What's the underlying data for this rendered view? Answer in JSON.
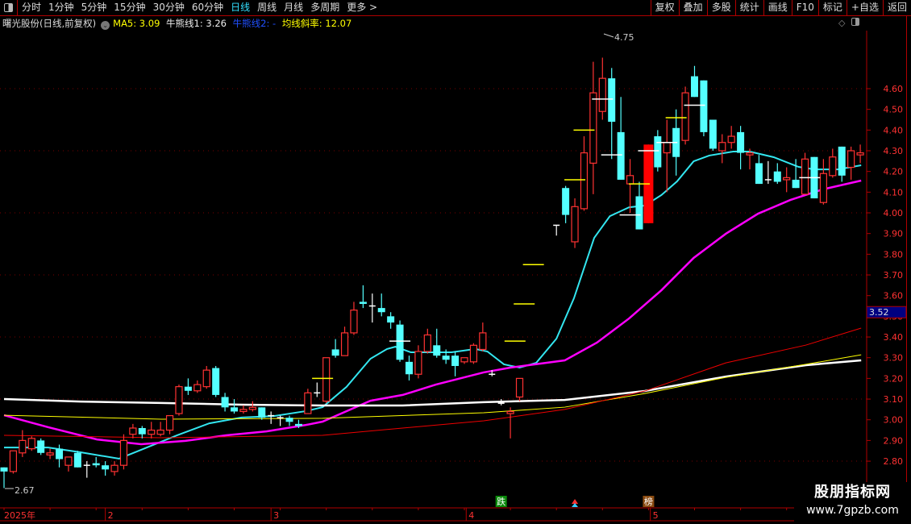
{
  "toolbar": {
    "periods": [
      "分时",
      "1分钟",
      "5分钟",
      "15分钟",
      "30分钟",
      "60分钟",
      "日线",
      "周线",
      "月线",
      "多周期",
      "更多 >"
    ],
    "active_period": "日线",
    "tools": [
      "复权",
      "叠加",
      "多股",
      "统计",
      "画线",
      "F10",
      "标记",
      "+自选",
      "返回"
    ]
  },
  "info": {
    "title": "曙光股份(日线,前复权)",
    "ma5": "MA5: 3.09",
    "bull_bear1": "牛熊线1: 3.26",
    "bull_bear2": "牛熊线2: -",
    "slope": "均线斜率: 12.07"
  },
  "colors": {
    "up": "#ff3232",
    "down": "#54ffff",
    "doji": "#ffffff",
    "axis": "#b00000",
    "axis_text": "#ff3232",
    "ma_cyan": "#33e6f0",
    "ma_magenta": "#ff00ff",
    "ma_white": "#ffffff",
    "ma_yellow": "#ffff00",
    "ma_red": "#ee0000"
  },
  "price_axis": {
    "labels": [
      "4.60",
      "4.50",
      "4.40",
      "4.30",
      "4.20",
      "4.10",
      "4.00",
      "3.90",
      "3.80",
      "3.70",
      "3.60",
      "3.50",
      "3.40",
      "3.30",
      "3.20",
      "3.10",
      "3.00",
      "2.90",
      "2.80"
    ],
    "current_price": "3.52"
  },
  "annotations": {
    "high": "4.75",
    "low": "2.67"
  },
  "date_axis": [
    {
      "label": "2025年",
      "i": 0
    },
    {
      "label": "2",
      "i": 11
    },
    {
      "label": "3",
      "i": 29
    },
    {
      "label": "4",
      "i": 50.2
    },
    {
      "label": "5",
      "i": 70.2
    }
  ],
  "signals": [
    {
      "label": "跌",
      "i": 54,
      "color": "#0a8a0a"
    },
    {
      "label": "榜",
      "i": 70,
      "color": "#8a4a10"
    }
  ],
  "watermark": {
    "line1": "股朋指标网",
    "line2": "www.7gpzb.com"
  },
  "chart_data": {
    "type": "candlestick",
    "ylim": [
      2.62,
      4.85
    ],
    "candles": [
      [
        2.77,
        2.77,
        2.67,
        2.75
      ],
      [
        2.75,
        2.85,
        2.74,
        2.85
      ],
      [
        2.84,
        2.95,
        2.82,
        2.9
      ],
      [
        2.86,
        2.92,
        2.85,
        2.91
      ],
      [
        2.9,
        2.91,
        2.83,
        2.84
      ],
      [
        2.83,
        2.86,
        2.81,
        2.84
      ],
      [
        2.86,
        2.88,
        2.77,
        2.81
      ],
      [
        2.78,
        2.82,
        2.75,
        2.82
      ],
      [
        2.84,
        2.85,
        2.77,
        2.77
      ],
      [
        2.78,
        2.8,
        2.72,
        2.78
      ],
      [
        2.79,
        2.82,
        2.77,
        2.78
      ],
      [
        2.78,
        2.8,
        2.73,
        2.76
      ],
      [
        2.75,
        2.8,
        2.73,
        2.78
      ],
      [
        2.78,
        2.93,
        2.76,
        2.9
      ],
      [
        2.93,
        2.98,
        2.91,
        2.96
      ],
      [
        2.96,
        2.97,
        2.91,
        2.93
      ],
      [
        2.93,
        2.99,
        2.91,
        2.95
      ],
      [
        2.93,
        2.99,
        2.92,
        2.95
      ],
      [
        2.95,
        3.02,
        2.93,
        3.02
      ],
      [
        3.03,
        3.17,
        3.02,
        3.16
      ],
      [
        3.16,
        3.2,
        3.12,
        3.14
      ],
      [
        3.14,
        3.19,
        3.13,
        3.17
      ],
      [
        3.16,
        3.26,
        3.15,
        3.24
      ],
      [
        3.25,
        3.26,
        3.11,
        3.12
      ],
      [
        3.11,
        3.13,
        3.04,
        3.06
      ],
      [
        3.06,
        3.1,
        3.03,
        3.04
      ],
      [
        3.04,
        3.07,
        3.03,
        3.05
      ],
      [
        3.05,
        3.09,
        3.04,
        3.06
      ],
      [
        3.06,
        3.06,
        3.0,
        3.01
      ],
      [
        3.02,
        3.04,
        2.98,
        3.02
      ],
      [
        3.01,
        3.02,
        2.97,
        3.01
      ],
      [
        3.01,
        3.02,
        2.97,
        2.99
      ],
      [
        2.98,
        3.0,
        2.96,
        2.97
      ],
      [
        3.03,
        3.15,
        3.03,
        3.13
      ],
      [
        3.13,
        3.18,
        3.11,
        3.13
      ],
      [
        3.09,
        3.3,
        3.08,
        3.3
      ],
      [
        3.34,
        3.39,
        3.3,
        3.31
      ],
      [
        3.31,
        3.45,
        3.31,
        3.42
      ],
      [
        3.42,
        3.57,
        3.41,
        3.53
      ],
      [
        3.57,
        3.65,
        3.54,
        3.56
      ],
      [
        3.55,
        3.61,
        3.47,
        3.55
      ],
      [
        3.54,
        3.61,
        3.5,
        3.52
      ],
      [
        3.5,
        3.52,
        3.44,
        3.47
      ],
      [
        3.46,
        3.48,
        3.28,
        3.29
      ],
      [
        3.28,
        3.31,
        3.19,
        3.22
      ],
      [
        3.22,
        3.36,
        3.2,
        3.33
      ],
      [
        3.33,
        3.44,
        3.32,
        3.41
      ],
      [
        3.36,
        3.44,
        3.3,
        3.31
      ],
      [
        3.31,
        3.34,
        3.27,
        3.29
      ],
      [
        3.31,
        3.33,
        3.21,
        3.26
      ],
      [
        3.28,
        3.3,
        3.27,
        3.3
      ],
      [
        3.28,
        3.37,
        3.27,
        3.36
      ],
      [
        3.34,
        3.47,
        3.33,
        3.42
      ],
      [
        3.22,
        3.24,
        3.21,
        3.22
      ],
      [
        3.08,
        3.1,
        3.07,
        3.08
      ],
      [
        3.03,
        3.06,
        2.91,
        3.04
      ],
      [
        3.11,
        3.2,
        3.09,
        3.2
      ],
      null,
      null,
      null,
      [
        3.94,
        3.94,
        3.89,
        3.94
      ],
      [
        4.12,
        4.13,
        3.95,
        3.99
      ],
      [
        3.86,
        4.07,
        3.83,
        4.03
      ],
      [
        4.02,
        4.37,
        4.01,
        4.29
      ],
      [
        4.24,
        4.73,
        4.09,
        4.58
      ],
      [
        4.49,
        4.75,
        4.45,
        4.65
      ],
      [
        4.65,
        4.7,
        4.26,
        4.44
      ],
      [
        4.39,
        4.56,
        4.16,
        4.16
      ],
      [
        4.14,
        4.26,
        4.0,
        4.18
      ],
      [
        4.08,
        4.15,
        3.92,
        3.92
      ],
      [
        3.95,
        4.33,
        3.95,
        4.33
      ],
      [
        4.37,
        4.4,
        4.2,
        4.22
      ],
      [
        4.29,
        4.45,
        4.1,
        4.34
      ],
      [
        4.41,
        4.5,
        4.18,
        4.27
      ],
      [
        4.35,
        4.61,
        4.33,
        4.58
      ],
      [
        4.66,
        4.71,
        4.56,
        4.56
      ],
      [
        4.64,
        4.64,
        4.37,
        4.39
      ],
      [
        4.45,
        4.45,
        4.3,
        4.31
      ],
      [
        4.3,
        4.38,
        4.24,
        4.34
      ],
      [
        4.34,
        4.42,
        4.31,
        4.37
      ],
      [
        4.39,
        4.42,
        4.21,
        4.29
      ],
      [
        4.28,
        4.31,
        4.21,
        4.29
      ],
      [
        4.24,
        4.28,
        4.14,
        4.14
      ],
      [
        4.16,
        4.25,
        4.14,
        4.16
      ],
      [
        4.2,
        4.24,
        4.14,
        4.15
      ],
      [
        4.16,
        4.22,
        4.1,
        4.17
      ],
      [
        4.16,
        4.26,
        4.12,
        4.12
      ],
      [
        4.09,
        4.29,
        4.09,
        4.26
      ],
      [
        4.27,
        4.27,
        4.07,
        4.07
      ],
      [
        4.05,
        4.26,
        4.04,
        4.19
      ],
      [
        4.18,
        4.31,
        4.17,
        4.27
      ],
      [
        4.32,
        4.32,
        4.15,
        4.18
      ],
      [
        4.22,
        4.32,
        4.16,
        4.3
      ],
      [
        4.28,
        4.33,
        4.24,
        4.29
      ]
    ],
    "limit_up_filled": [
      70
    ],
    "markers": [
      {
        "i": 34.6,
        "p": 3.2,
        "color": "yellow"
      },
      {
        "i": 55.5,
        "p": 3.38,
        "color": "yellow"
      },
      {
        "i": 56.5,
        "p": 3.56,
        "color": "yellow"
      },
      {
        "i": 57.5,
        "p": 3.75,
        "color": "yellow"
      },
      {
        "i": 62,
        "p": 4.16,
        "color": "yellow"
      },
      {
        "i": 63,
        "p": 4.4,
        "color": "yellow"
      },
      {
        "i": 69,
        "p": 4.14,
        "color": "yellow"
      },
      {
        "i": 73,
        "p": 4.46,
        "color": "yellow"
      },
      {
        "i": 43,
        "p": 3.38,
        "color": "white"
      },
      {
        "i": 65,
        "p": 4.55,
        "color": "white"
      },
      {
        "i": 66,
        "p": 4.28,
        "color": "white"
      },
      {
        "i": 68,
        "p": 3.99,
        "color": "white"
      },
      {
        "i": 70,
        "p": 4.3,
        "color": "white"
      },
      {
        "i": 72,
        "p": 4.34,
        "color": "white"
      },
      {
        "i": 75,
        "p": 4.52,
        "color": "white"
      },
      {
        "i": 87.5,
        "p": 4.17,
        "color": "white"
      }
    ],
    "lines": [
      {
        "name": "cyan",
        "points": [
          [
            0,
            2.866
          ],
          [
            4.8,
            2.866
          ],
          [
            8.3,
            2.843
          ],
          [
            12.5,
            2.812
          ],
          [
            14.9,
            2.855
          ],
          [
            18.8,
            2.925
          ],
          [
            22.3,
            2.983
          ],
          [
            25.8,
            3.011
          ],
          [
            29.3,
            3.018
          ],
          [
            32.8,
            3.042
          ],
          [
            34.6,
            3.061
          ],
          [
            37.2,
            3.159
          ],
          [
            39.8,
            3.295
          ],
          [
            41.6,
            3.342
          ],
          [
            42.5,
            3.353
          ],
          [
            44.2,
            3.326
          ],
          [
            46,
            3.326
          ],
          [
            48.6,
            3.326
          ],
          [
            51.2,
            3.342
          ],
          [
            52.5,
            3.33
          ],
          [
            54.3,
            3.268
          ],
          [
            56,
            3.252
          ],
          [
            57.8,
            3.275
          ],
          [
            60,
            3.392
          ],
          [
            61.9,
            3.587
          ],
          [
            64.1,
            3.879
          ],
          [
            65.8,
            3.984
          ],
          [
            67.9,
            4.027
          ],
          [
            69.6,
            4.035
          ],
          [
            71.4,
            4.086
          ],
          [
            73.1,
            4.152
          ],
          [
            74.9,
            4.249
          ],
          [
            76.6,
            4.277
          ],
          [
            79.2,
            4.296
          ],
          [
            81,
            4.296
          ],
          [
            83.6,
            4.269
          ],
          [
            86.3,
            4.222
          ],
          [
            88,
            4.21
          ],
          [
            90.6,
            4.21
          ],
          [
            93.1,
            4.23
          ]
        ]
      },
      {
        "name": "magenta",
        "points": [
          [
            0,
            3.022
          ],
          [
            4.8,
            2.964
          ],
          [
            10.1,
            2.905
          ],
          [
            14.9,
            2.882
          ],
          [
            19.7,
            2.898
          ],
          [
            24.1,
            2.925
          ],
          [
            28.5,
            2.944
          ],
          [
            32.8,
            2.975
          ],
          [
            34.6,
            2.991
          ],
          [
            39.8,
            3.092
          ],
          [
            43.3,
            3.12
          ],
          [
            46.9,
            3.17
          ],
          [
            52.1,
            3.229
          ],
          [
            55,
            3.252
          ],
          [
            60.9,
            3.287
          ],
          [
            64.4,
            3.373
          ],
          [
            67.9,
            3.49
          ],
          [
            71.4,
            3.626
          ],
          [
            74.9,
            3.782
          ],
          [
            78.4,
            3.899
          ],
          [
            81.9,
            3.996
          ],
          [
            85.4,
            4.062
          ],
          [
            88.9,
            4.113
          ],
          [
            93.1,
            4.156
          ]
        ]
      },
      {
        "name": "white",
        "points": [
          [
            0,
            3.1
          ],
          [
            8.3,
            3.088
          ],
          [
            17.1,
            3.081
          ],
          [
            25.8,
            3.073
          ],
          [
            34.6,
            3.069
          ],
          [
            43.3,
            3.069
          ],
          [
            52.1,
            3.085
          ],
          [
            60.9,
            3.096
          ],
          [
            69.6,
            3.139
          ],
          [
            78.4,
            3.209
          ],
          [
            87.1,
            3.264
          ],
          [
            93.1,
            3.287
          ]
        ]
      },
      {
        "name": "yellow",
        "points": [
          [
            0,
            3.022
          ],
          [
            17.1,
            3.003
          ],
          [
            34.6,
            3.007
          ],
          [
            52.1,
            3.034
          ],
          [
            60.9,
            3.061
          ],
          [
            69.6,
            3.127
          ],
          [
            78.4,
            3.205
          ],
          [
            87.1,
            3.268
          ],
          [
            93.1,
            3.314
          ]
        ]
      },
      {
        "name": "red",
        "points": [
          [
            0,
            2.925
          ],
          [
            17.1,
            2.913
          ],
          [
            34.6,
            2.925
          ],
          [
            52.1,
            2.995
          ],
          [
            60.9,
            3.05
          ],
          [
            69.6,
            3.139
          ],
          [
            78.4,
            3.275
          ],
          [
            87.1,
            3.361
          ],
          [
            93.1,
            3.443
          ]
        ]
      }
    ]
  }
}
